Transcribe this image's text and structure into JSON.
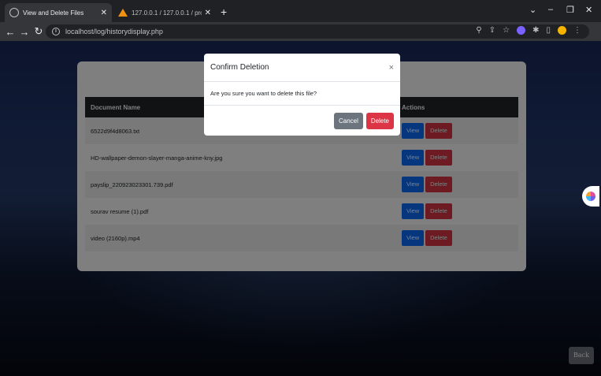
{
  "browser": {
    "tabs": [
      {
        "title": "View and Delete Files",
        "active": true
      },
      {
        "title": "127.0.0.1 / 127.0.0.1 / project / ...",
        "active": false
      }
    ],
    "url": "localhost/log/historydisplay.php",
    "new_tab": "+"
  },
  "table": {
    "headers": [
      "Document Name",
      "Actions"
    ],
    "rows": [
      {
        "name": "6522d9f4d8063.txt",
        "view": "View",
        "delete": "Delete"
      },
      {
        "name": "HD-wallpaper-demon-slayer-manga-anime-kny.jpg",
        "view": "View",
        "delete": "Delete"
      },
      {
        "name": "payslip_220923023301.739.pdf",
        "view": "View",
        "delete": "Delete"
      },
      {
        "name": "sourav resume (1).pdf",
        "view": "View",
        "delete": "Delete"
      },
      {
        "name": "video (2160p).mp4",
        "view": "View",
        "delete": "Delete"
      }
    ]
  },
  "back_button": "Back",
  "modal": {
    "title": "Confirm Deletion",
    "close": "×",
    "body": "Are you sure you want to delete this file?",
    "cancel": "Cancel",
    "delete": "Delete"
  },
  "colors": {
    "primary": "#0d6efd",
    "danger": "#dc3545",
    "secondary": "#6c757d",
    "table_header": "#212529"
  }
}
